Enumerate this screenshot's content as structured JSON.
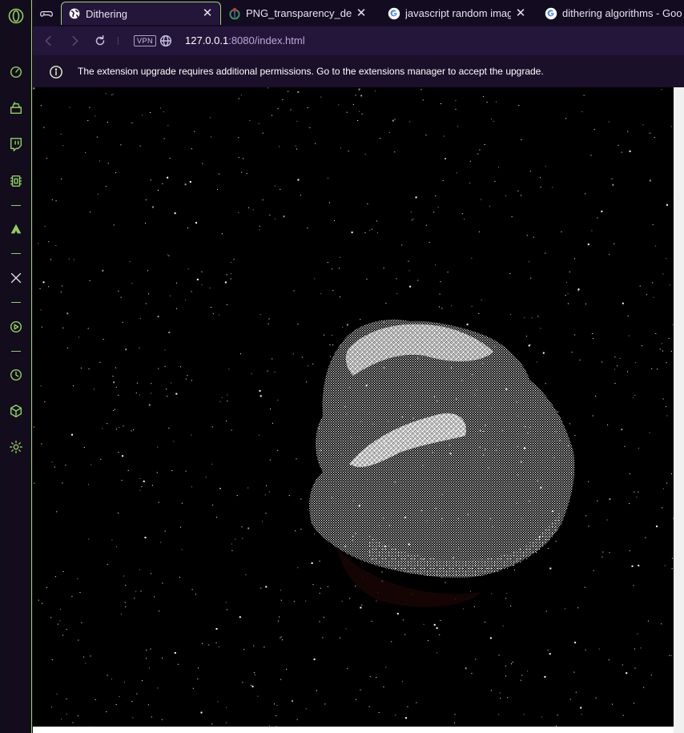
{
  "sidebar": {
    "items": [
      {
        "name": "opera-gx-logo-icon"
      },
      {
        "name": "speed-dial-icon"
      },
      {
        "name": "game-store-icon"
      },
      {
        "name": "twitch-icon"
      },
      {
        "name": "hardware-limiter-icon"
      },
      {
        "name": "app-icon"
      },
      {
        "name": "x-twitter-icon"
      },
      {
        "name": "player-icon"
      },
      {
        "name": "history-icon"
      },
      {
        "name": "extensions-icon"
      },
      {
        "name": "settings-icon"
      }
    ]
  },
  "tabs": [
    {
      "title": "",
      "icon": "gamepad-icon",
      "active": false
    },
    {
      "title": "Dithering",
      "icon": "globe-icon",
      "active": true
    },
    {
      "title": "PNG_transparency_demons",
      "icon": "wikimedia-icon",
      "active": false
    },
    {
      "title": "javascript random image ap",
      "icon": "google-icon",
      "active": false
    },
    {
      "title": "dithering algorithms - Goo",
      "icon": "google-icon",
      "active": false
    }
  ],
  "toolbar": {
    "vpn_label": "VPN",
    "url_host": "127.0.0.1",
    "url_path": ":8080/index.html"
  },
  "infobar": {
    "message": "The extension upgrade requires additional permissions. Go to the extensions manager to accept the upgrade."
  },
  "colors": {
    "accent": "#9cd66a",
    "tab_bg": "#24163a",
    "page_bg": "#000000"
  }
}
